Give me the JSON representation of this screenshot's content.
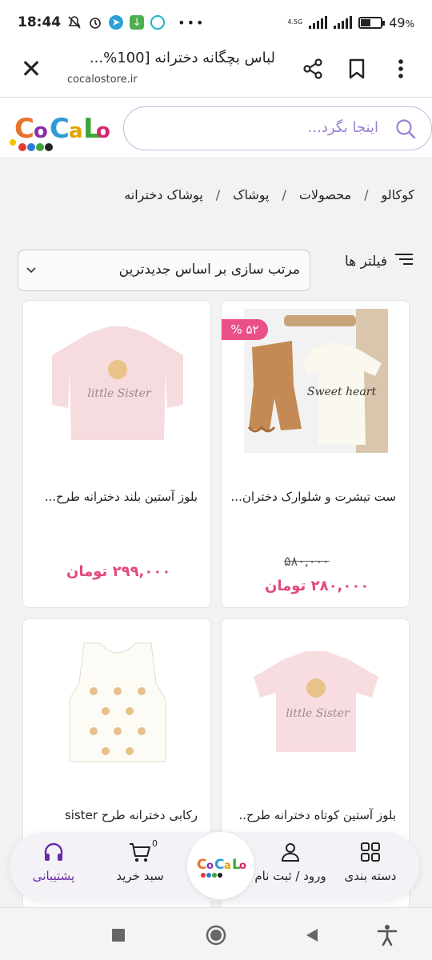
{
  "status_bar": {
    "time": "18:44",
    "battery": "49",
    "battery_unit": "%",
    "net": "4.5G",
    "battery_level": 0.49
  },
  "browser": {
    "title": "لباس بچگانه دخترانه [100%...",
    "url": "cocalostore.ir"
  },
  "site": {
    "search_placeholder": "اینجا بگرد...",
    "logo_text": "CoCaLo",
    "colors": {
      "accent": "#9b7fd3",
      "price": "#e14a7b",
      "discount": "#ea4f87"
    }
  },
  "breadcrumb": [
    "کوکالو",
    "محصولات",
    "پوشاک",
    "پوشاک دخترانه"
  ],
  "breadcrumb_sep": "/",
  "toolbar": {
    "filters_label": "فیلتر ها",
    "sort_label": "مرتب سازی بر اساس جدیدترین"
  },
  "products": [
    {
      "name": "ست تیشرت و شلوارک دختران...",
      "old_price": "۵۸۰,۰۰۰",
      "price": "۲۸۰,۰۰۰",
      "currency": "تومان",
      "discount": "۵۲ %"
    },
    {
      "name": "بلوز آستین بلند دخترانه طرح...",
      "price": "۲۹۹,۰۰۰",
      "currency": "تومان"
    },
    {
      "name": "بلوز آستین کوتاه دخترانه طرح..",
      "print": "little Sister"
    },
    {
      "name": "رکابی دخترانه طرح sister"
    }
  ],
  "garment_prints": {
    "sweet_heart": "Sweet heart",
    "little_sister": "little Sister"
  },
  "bottom_nav": {
    "categories": "دسته بندی",
    "login": "ورود / ثبت نام",
    "cart": "سبد خرید",
    "cart_count": "0",
    "support": "پشتیبانی"
  }
}
